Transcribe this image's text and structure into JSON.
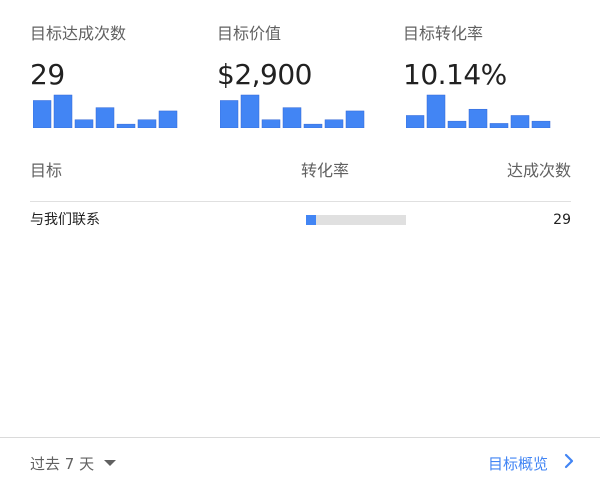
{
  "metrics": [
    {
      "label": "目标达成次数",
      "value": "29",
      "spark": [
        5,
        6,
        1.5,
        3.7,
        0.7,
        1.5,
        3.1
      ]
    },
    {
      "label": "目标价值",
      "value": "$2,900",
      "spark": [
        5,
        6,
        1.5,
        3.7,
        0.7,
        1.5,
        3.1
      ]
    },
    {
      "label": "目标转化率",
      "value": "10.14%",
      "spark": [
        2.2,
        5.8,
        1.2,
        3.3,
        0.8,
        2.2,
        1.2
      ]
    }
  ],
  "table": {
    "headers": {
      "goal": "目标",
      "rate": "转化率",
      "count": "达成次数"
    },
    "rows": [
      {
        "name": "与我们联系",
        "rate_fraction": 0.1014,
        "count": "29"
      }
    ]
  },
  "footer": {
    "range_label": "过去 7 天",
    "overview_label": "目标概览"
  },
  "colors": {
    "accent": "#4285f4",
    "track": "#e0e0e0",
    "muted_text": "#616161"
  },
  "icons": {
    "range_caret": "caret-down-icon",
    "overview_chevron": "chevron-right-icon"
  }
}
